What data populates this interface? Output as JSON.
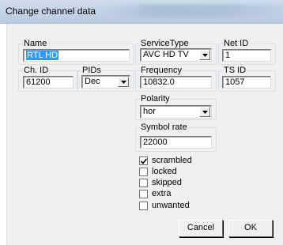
{
  "window": {
    "title": "Change channel data"
  },
  "name_group": {
    "legend": "Name",
    "value": "RTL HD"
  },
  "service_type_group": {
    "legend": "ServiceType",
    "selected": "AVC HD TV"
  },
  "net_id_group": {
    "legend": "Net ID",
    "value": "1"
  },
  "ch_id_group": {
    "legend": "Ch. ID",
    "value": "61200"
  },
  "pids_group": {
    "legend": "PIDs",
    "selected": "Dec"
  },
  "frequency_group": {
    "legend": "Frequency",
    "value": "10832.0"
  },
  "ts_id_group": {
    "legend": "TS ID",
    "value": "1057"
  },
  "polarity_group": {
    "legend": "Polarity",
    "selected": "hor"
  },
  "symbol_rate_group": {
    "legend": "Symbol rate",
    "value": "22000"
  },
  "flags": [
    {
      "label": "scrambled",
      "checked": true
    },
    {
      "label": "locked",
      "checked": false
    },
    {
      "label": "skipped",
      "checked": false
    },
    {
      "label": "extra",
      "checked": false
    },
    {
      "label": "unwanted",
      "checked": false
    }
  ],
  "buttons": {
    "cancel": "Cancel",
    "ok": "OK"
  },
  "icons": {
    "dropdown": "chevron-down-icon",
    "check": "check-icon"
  },
  "colors": {
    "selection": "#3399ff",
    "dialog_bg": "#f0f0f0",
    "titlebar": "#c4d3e7"
  }
}
